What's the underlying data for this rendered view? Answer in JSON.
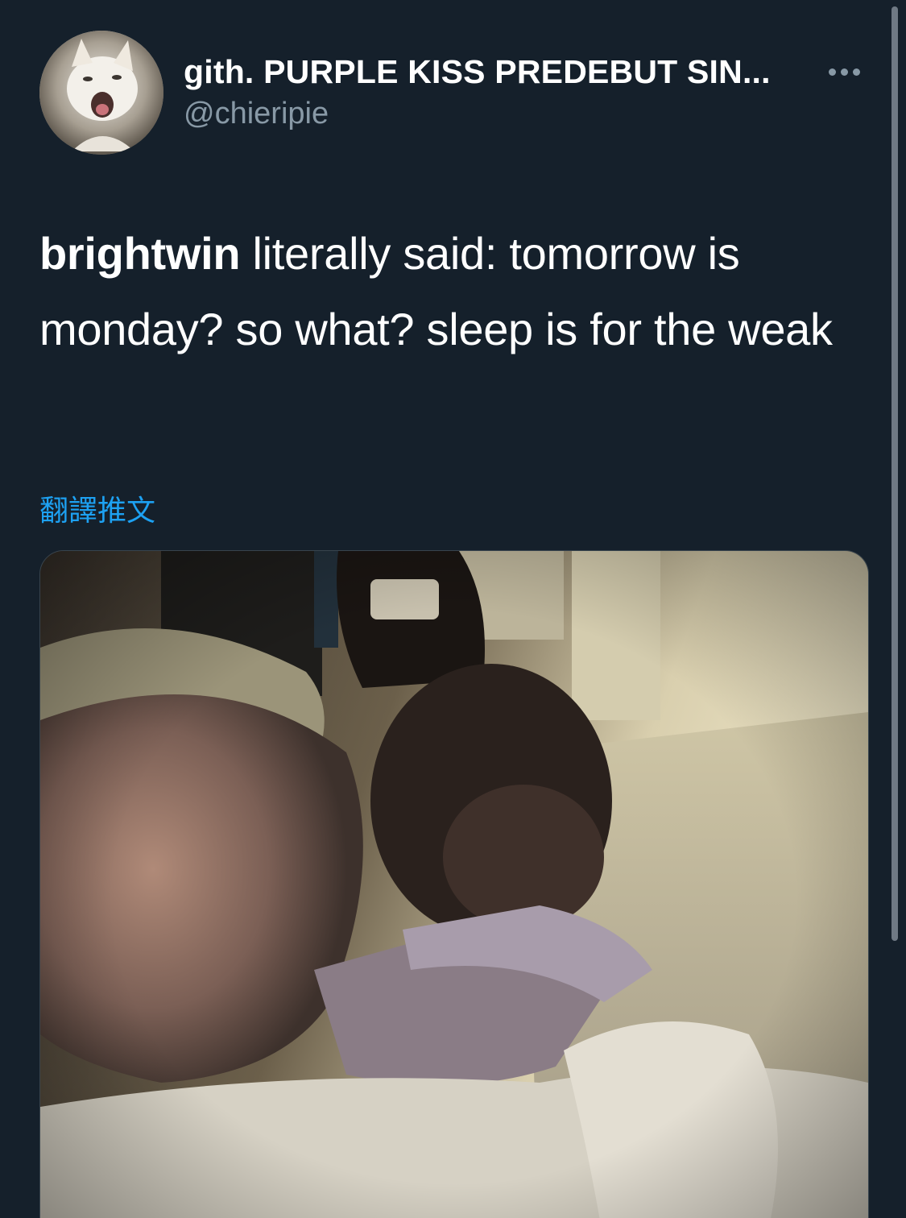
{
  "tweet": {
    "author": {
      "display_name": "gith. PURPLE KISS PREDEBUT SIN...",
      "handle": "@chieripie",
      "avatar_icon": "cat-avatar"
    },
    "text": {
      "bold_prefix": "brightwin",
      "body": " literally said: tomorrow is monday? so what? sleep is for the weak"
    },
    "translate_label": "翻譯推文",
    "more_icon": "more-horizontal-icon",
    "media": {
      "type": "video"
    }
  },
  "colors": {
    "background": "#15202b",
    "primary_text": "#ffffff",
    "secondary_text": "#8899a6",
    "link": "#1da1f2"
  }
}
